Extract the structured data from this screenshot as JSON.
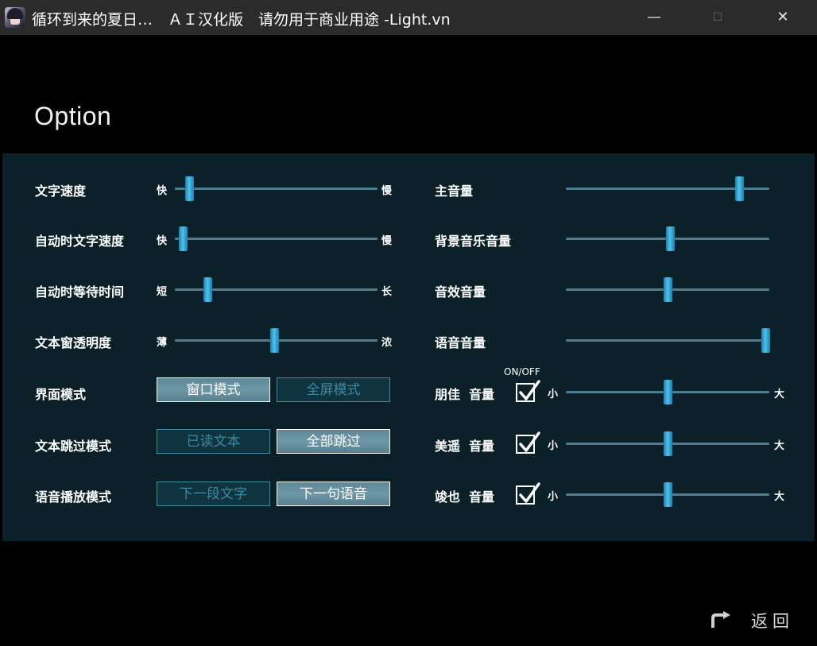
{
  "window": {
    "title": "循环到来的夏日…　ＡＩ汉化版　请勿用于商业用途 -Light.vn",
    "min_glyph": "—",
    "max_glyph": "☐",
    "close_glyph": "✕"
  },
  "page": {
    "title": "Option"
  },
  "left_sliders": [
    {
      "label": "文字速度",
      "min": "快",
      "max": "慢",
      "value": 0.07
    },
    {
      "label": "自动时文字速度",
      "min": "快",
      "max": "慢",
      "value": 0.04
    },
    {
      "label": "自动时等待时间",
      "min": "短",
      "max": "长",
      "value": 0.16
    },
    {
      "label": "文本窗透明度",
      "min": "薄",
      "max": "浓",
      "value": 0.49
    }
  ],
  "mode_rows": [
    {
      "label": "界面模式",
      "options": [
        "窗口模式",
        "全屏模式"
      ],
      "selected": 0
    },
    {
      "label": "文本跳过模式",
      "options": [
        "已读文本",
        "全部跳过"
      ],
      "selected": 1
    },
    {
      "label": "语音播放模式",
      "options": [
        "下一段文字",
        "下一句语音"
      ],
      "selected": 1
    }
  ],
  "volume_sliders": [
    {
      "label": "主音量",
      "value": 0.85
    },
    {
      "label": "背景音乐音量",
      "value": 0.51
    },
    {
      "label": "音效音量",
      "value": 0.5
    },
    {
      "label": "语音音量",
      "value": 0.98
    }
  ],
  "character_voice": {
    "onoff_label": "ON/OFF",
    "min": "小",
    "max": "大",
    "items": [
      {
        "name": "朋佳",
        "suffix": "音量",
        "enabled": true,
        "value": 0.5
      },
      {
        "name": "美遥",
        "suffix": "音量",
        "enabled": true,
        "value": 0.5
      },
      {
        "name": "竣也",
        "suffix": "音量",
        "enabled": true,
        "value": 0.5
      }
    ]
  },
  "footer": {
    "back_label": "返回",
    "back_icon": "return-arrow-icon"
  },
  "colors": {
    "panel": "#0b2029",
    "track": "#4d7f8f",
    "thumb": "#3cb5e6",
    "accent_text": "#3a8ba0"
  }
}
